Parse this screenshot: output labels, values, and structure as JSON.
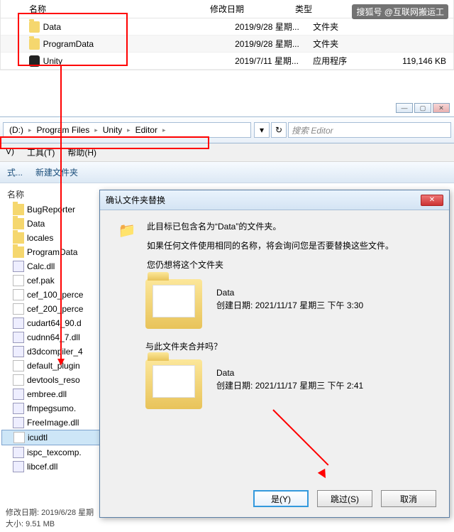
{
  "watermark": "搜狐号 @互联网搬运工",
  "top_list": {
    "headers": {
      "name": "名称",
      "date": "修改日期",
      "type": "类型",
      "size": ""
    },
    "rows": [
      {
        "icon": "folder",
        "name": "Data",
        "date": "2019/9/28 星期...",
        "type": "文件夹",
        "size": ""
      },
      {
        "icon": "folder",
        "name": "ProgramData",
        "date": "2019/9/28 星期...",
        "type": "文件夹",
        "size": ""
      },
      {
        "icon": "unity",
        "name": "Unity",
        "date": "2019/7/11 星期...",
        "type": "应用程序",
        "size": "119,146 KB"
      }
    ]
  },
  "breadcrumb": {
    "drive": "(D:)",
    "parts": [
      "Program Files",
      "Unity",
      "Editor"
    ]
  },
  "search": {
    "placeholder": "搜索 Editor"
  },
  "menu": {
    "v": "V)",
    "tools": "工具(T)",
    "help": "帮助(H)"
  },
  "toolbar": {
    "new_folder": "新建文件夹",
    "style": "式..."
  },
  "file_list": {
    "header": "名称",
    "items": [
      {
        "icon": "folder",
        "name": "BugReporter"
      },
      {
        "icon": "folder",
        "name": "Data"
      },
      {
        "icon": "folder",
        "name": "locales"
      },
      {
        "icon": "folder",
        "name": "ProgramData"
      },
      {
        "icon": "dll",
        "name": "Calc.dll"
      },
      {
        "icon": "file",
        "name": "cef.pak"
      },
      {
        "icon": "file",
        "name": "cef_100_perce"
      },
      {
        "icon": "file",
        "name": "cef_200_perce"
      },
      {
        "icon": "dll",
        "name": "cudart64_90.d"
      },
      {
        "icon": "dll",
        "name": "cudnn64_7.dll"
      },
      {
        "icon": "dll",
        "name": "d3dcompiler_4"
      },
      {
        "icon": "file",
        "name": "default_plugin"
      },
      {
        "icon": "file",
        "name": "devtools_reso"
      },
      {
        "icon": "dll",
        "name": "embree.dll"
      },
      {
        "icon": "dll",
        "name": "ffmpegsumo."
      },
      {
        "icon": "dll",
        "name": "FreeImage.dll"
      },
      {
        "icon": "file",
        "name": "icudtl",
        "selected": true
      },
      {
        "icon": "dll",
        "name": "ispc_texcomp."
      },
      {
        "icon": "dll",
        "name": "libcef.dll"
      }
    ]
  },
  "status": {
    "date_label": "修改日期:",
    "date": "2019/6/28 星期",
    "size_label": "大小:",
    "size": "9.51 MB"
  },
  "dialog": {
    "title": "确认文件夹替换",
    "msg1": "此目标已包含名为“Data”的文件夹。",
    "msg2": "如果任何文件使用相同的名称，将会询问您是否要替换这些文件。",
    "msg3": "您仍想将这个文件夹",
    "folder1": {
      "name": "Data",
      "date_label": "创建日期:",
      "date": "2021/11/17 星期三 下午 3:30"
    },
    "question": "与此文件夹合并吗？",
    "folder2": {
      "name": "Data",
      "date_label": "创建日期:",
      "date": "2021/11/17 星期三 下午 2:41"
    },
    "buttons": {
      "yes": "是(Y)",
      "skip": "跳过(S)",
      "cancel": "取消"
    }
  }
}
